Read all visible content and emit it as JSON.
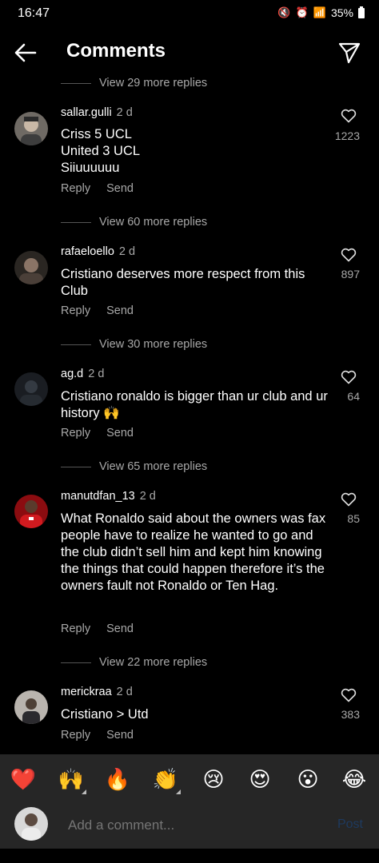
{
  "status": {
    "time": "16:47",
    "battery": "35%"
  },
  "header": {
    "title": "Comments"
  },
  "view_more": [
    "View 29 more replies",
    "View 60 more replies",
    "View 30 more replies",
    "View 65 more replies",
    "View 22 more replies"
  ],
  "comments": [
    {
      "user": "sallar.gulli",
      "ago": "2 d",
      "text": "Criss 5 UCL\nUnited 3 UCL\nSiiuuuuuu",
      "likes": "1223"
    },
    {
      "user": "rafaeloello",
      "ago": "2 d",
      "text": "Cristiano deserves more respect from this Club",
      "likes": "897"
    },
    {
      "user": "ag.d",
      "ago": "2 d",
      "text": "Cristiano ronaldo is bigger than ur club and ur history 🙌",
      "likes": "64"
    },
    {
      "user": "manutdfan_13",
      "ago": "2 d",
      "text": "What Ronaldo said about the owners was fax people have to realize he wanted to go and the club didn’t sell him and kept him knowing the things that could happen therefore it’s the owners fault not Ronaldo or Ten Hag.",
      "likes": "85"
    },
    {
      "user": "merickraa",
      "ago": "2 d",
      "text": "Cristiano > Utd",
      "likes": "383"
    }
  ],
  "actions": {
    "reply": "Reply",
    "send": "Send"
  },
  "reactions": [
    "❤️",
    "🙌",
    "🔥",
    "👏",
    "😢",
    "😍",
    "😮",
    "😂"
  ],
  "composer": {
    "placeholder": "Add a comment...",
    "post": "Post"
  }
}
